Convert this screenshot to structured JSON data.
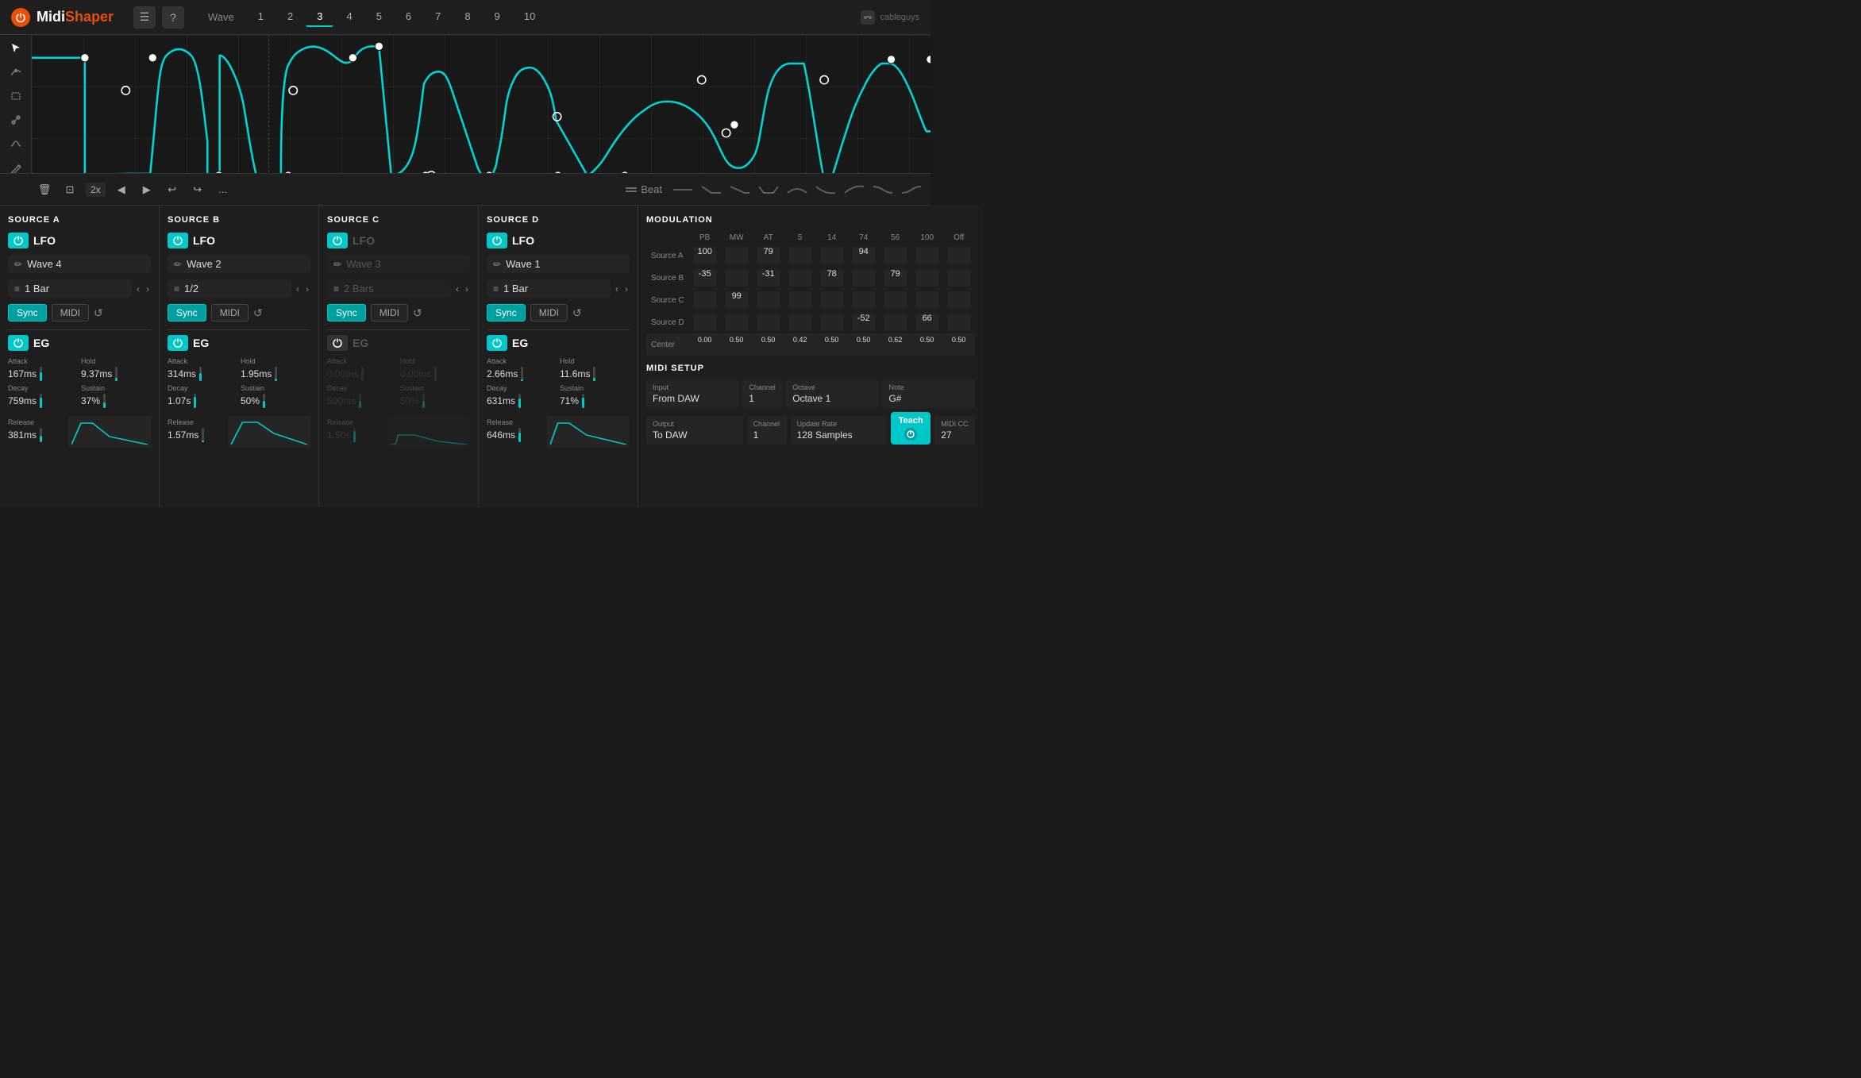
{
  "app": {
    "name": "MidiShaper",
    "name_midi": "Midi",
    "name_shaper": "Shaper",
    "cableguys": "cableguys"
  },
  "header": {
    "menu_label": "☰",
    "help_label": "?",
    "wave_tab_label": "Wave",
    "tabs": [
      "1",
      "2",
      "3",
      "4",
      "5",
      "6",
      "7",
      "8",
      "9",
      "10"
    ],
    "active_tab": "3"
  },
  "toolbar": {
    "zoom_label": "2x",
    "undo_label": "↩",
    "redo_label": "↪",
    "more_label": "...",
    "beat_label": "Beat"
  },
  "source_a": {
    "title": "SOURCE A",
    "lfo_label": "LFO",
    "wave_name": "Wave 4",
    "bar_value": "1 Bar",
    "sync_label": "Sync",
    "midi_label": "MIDI",
    "eg_label": "EG",
    "attack_label": "Attack",
    "attack_value": "167ms",
    "hold_label": "Hold",
    "hold_value": "9.37ms",
    "decay_label": "Decay",
    "decay_value": "759ms",
    "sustain_label": "Sustain",
    "sustain_value": "37%",
    "release_label": "Release",
    "release_value": "381ms",
    "enabled": true,
    "eg_enabled": true
  },
  "source_b": {
    "title": "SOURCE B",
    "lfo_label": "LFO",
    "wave_name": "Wave 2",
    "bar_value": "1/2",
    "sync_label": "Sync",
    "midi_label": "MIDI",
    "eg_label": "EG",
    "attack_label": "Attack",
    "attack_value": "314ms",
    "hold_label": "Hold",
    "hold_value": "1.95ms",
    "decay_label": "Decay",
    "decay_value": "1.07s",
    "sustain_label": "Sustain",
    "sustain_value": "50%",
    "release_label": "Release",
    "release_value": "1.57ms",
    "enabled": true,
    "eg_enabled": true
  },
  "source_c": {
    "title": "SOURCE C",
    "lfo_label": "LFO",
    "wave_name": "Wave 3",
    "bar_value": "2 Bars",
    "sync_label": "Sync",
    "midi_label": "MIDI",
    "eg_label": "EG",
    "attack_label": "Attack",
    "attack_value": "0.00ms",
    "hold_label": "Hold",
    "hold_value": "0.00ms",
    "decay_label": "Decay",
    "decay_value": "500ms",
    "sustain_label": "Sustain",
    "sustain_value": "50%",
    "release_label": "Release",
    "release_value": "1.50s",
    "enabled": true,
    "eg_enabled": false
  },
  "source_d": {
    "title": "SOURCE D",
    "lfo_label": "LFO",
    "wave_name": "Wave 1",
    "bar_value": "1 Bar",
    "sync_label": "Sync",
    "midi_label": "MIDI",
    "eg_label": "EG",
    "attack_label": "Attack",
    "attack_value": "2.66ms",
    "hold_label": "Hold",
    "hold_value": "11.6ms",
    "decay_label": "Decay",
    "decay_value": "631ms",
    "sustain_label": "Sustain",
    "sustain_value": "71%",
    "release_label": "Release",
    "release_value": "646ms",
    "enabled": true,
    "eg_enabled": true
  },
  "modulation": {
    "title": "MODULATION",
    "col_headers": [
      "PB",
      "MW",
      "AT",
      "5",
      "14",
      "74",
      "56",
      "100",
      "Off"
    ],
    "row_labels": [
      "Source A",
      "Source B",
      "Source C",
      "Source D",
      "Center"
    ],
    "source_a_values": {
      "PB": "100",
      "AT": "79",
      "74": "94"
    },
    "source_b_values": {
      "PB": "-35",
      "AT": "-31",
      "14": "78",
      "56": "79"
    },
    "source_c_values": {
      "MW": "99"
    },
    "source_d_values": {
      "74": "-52",
      "100": "66"
    },
    "center_values": {
      "PB": "0.00",
      "MW": "0.50",
      "AT": "0.50",
      "5": "0.42",
      "14": "0.50",
      "74": "0.50",
      "56": "0.62",
      "100": "0.50",
      "Off": "0.50"
    }
  },
  "midi_setup": {
    "title": "MIDI SETUP",
    "input_label": "Input",
    "input_value": "From DAW",
    "input_channel_label": "Channel",
    "input_channel_value": "1",
    "octave_label": "Octave",
    "octave_value": "Octave 1",
    "note_label": "Note",
    "note_value": "G#",
    "output_label": "Output",
    "output_value": "To DAW",
    "output_channel_label": "Channel",
    "output_channel_value": "1",
    "update_rate_label": "Update Rate",
    "update_rate_value": "128 Samples",
    "teach_label": "Teach",
    "midi_cc_label": "MIDI CC",
    "midi_cc_value": "27"
  },
  "colors": {
    "accent": "#00c8c8",
    "accent_dark": "#00a0a0",
    "bg_dark": "#1e1e1e",
    "bg_mid": "#252525",
    "border": "#333",
    "text_primary": "#ffffff",
    "text_secondary": "#aaaaaa",
    "text_muted": "#666666",
    "power_orange": "#e8500a"
  }
}
